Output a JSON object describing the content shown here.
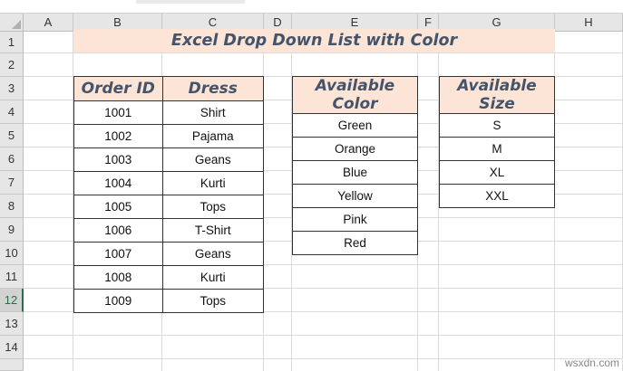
{
  "columns": [
    "A",
    "B",
    "C",
    "D",
    "E",
    "F",
    "G",
    "H"
  ],
  "rows": [
    "1",
    "2",
    "3",
    "4",
    "5",
    "6",
    "7",
    "8",
    "9",
    "10",
    "11",
    "12",
    "13",
    "14"
  ],
  "title": "Excel Drop Down List with Color",
  "orders": {
    "headers": [
      "Order ID",
      "Dress"
    ],
    "rows": [
      [
        "1001",
        "Shirt"
      ],
      [
        "1002",
        "Pajama"
      ],
      [
        "1003",
        "Geans"
      ],
      [
        "1004",
        "Kurti"
      ],
      [
        "1005",
        "Tops"
      ],
      [
        "1006",
        "T-Shirt"
      ],
      [
        "1007",
        "Geans"
      ],
      [
        "1008",
        "Kurti"
      ],
      [
        "1009",
        "Tops"
      ]
    ]
  },
  "colors": {
    "header": "Available Color",
    "items": [
      "Green",
      "Orange",
      "Blue",
      "Yellow",
      "Pink",
      "Red"
    ]
  },
  "sizes": {
    "header": "Available Size",
    "items": [
      "S",
      "M",
      "XL",
      "XXL"
    ]
  },
  "watermark": "wsxdn.com"
}
